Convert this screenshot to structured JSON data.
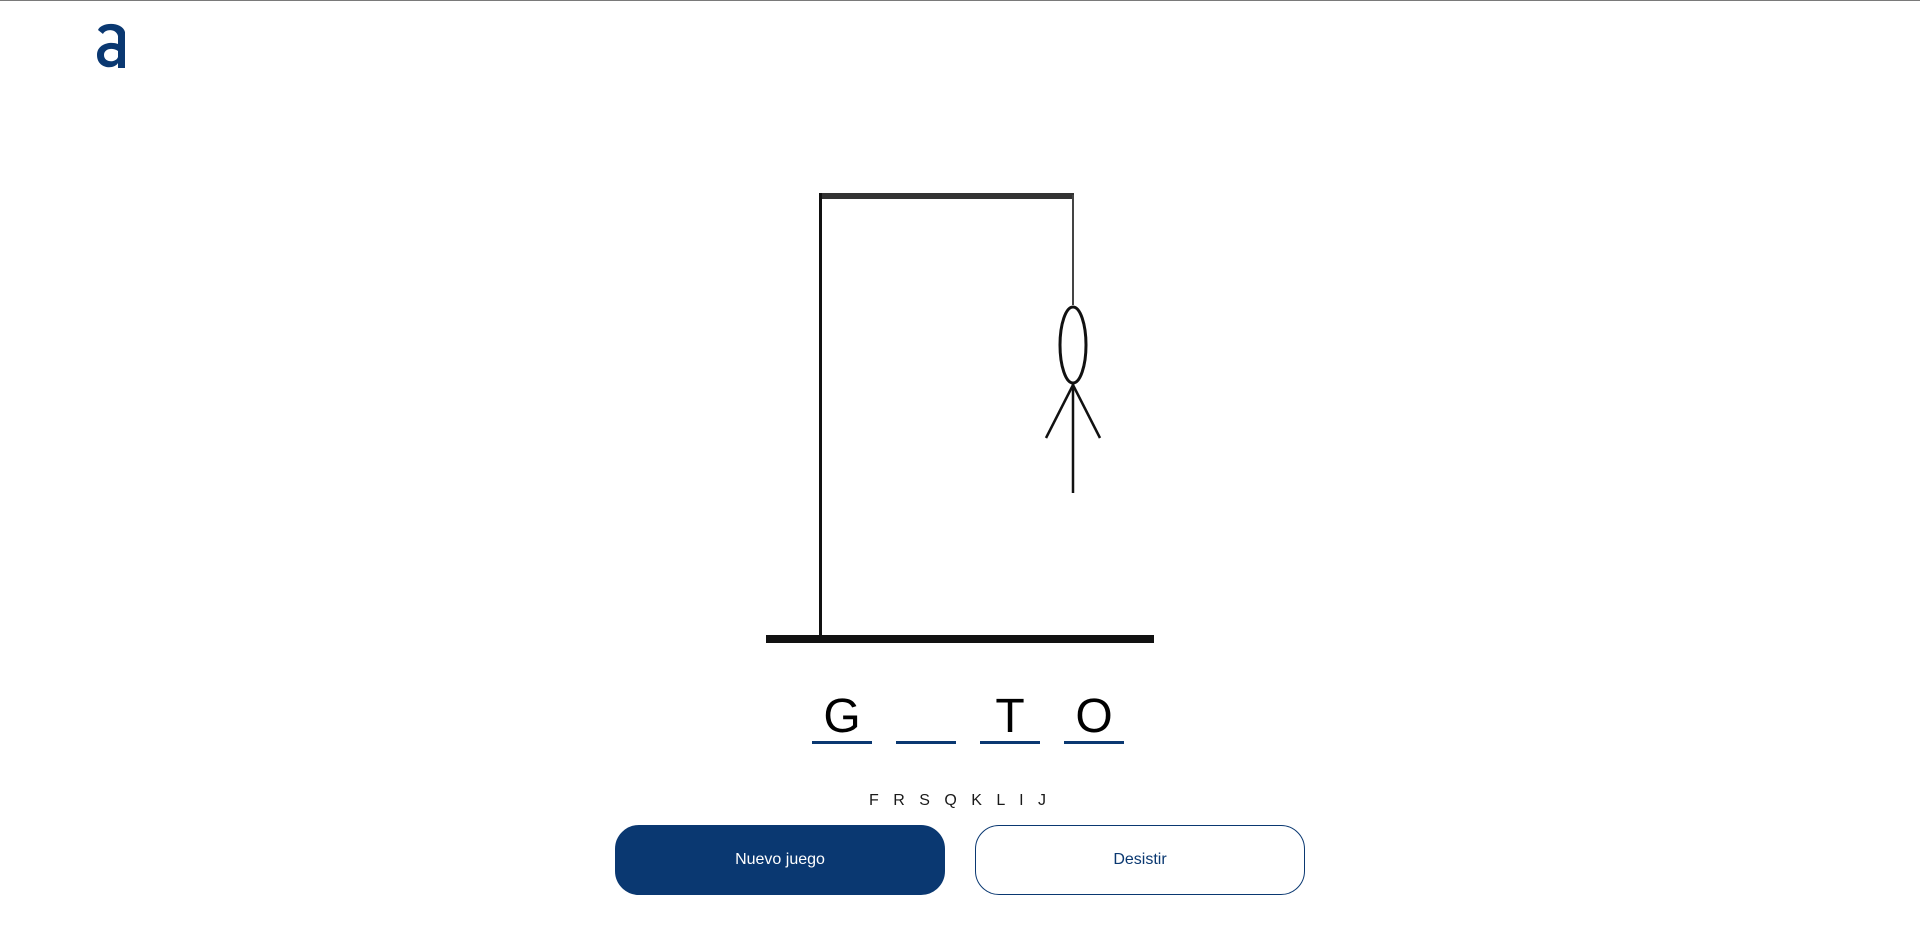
{
  "header": {
    "logo_icon": "alura-logo-icon",
    "logo_color": "#0a3871"
  },
  "game": {
    "word_slots": [
      "G",
      "",
      "T",
      "O"
    ],
    "wrong_letters": "F R S Q K L I J"
  },
  "actions": {
    "new_game_label": "Nuevo juego",
    "give_up_label": "Desistir"
  },
  "colors": {
    "accent": "#0a3871",
    "background": "#ffffff"
  }
}
